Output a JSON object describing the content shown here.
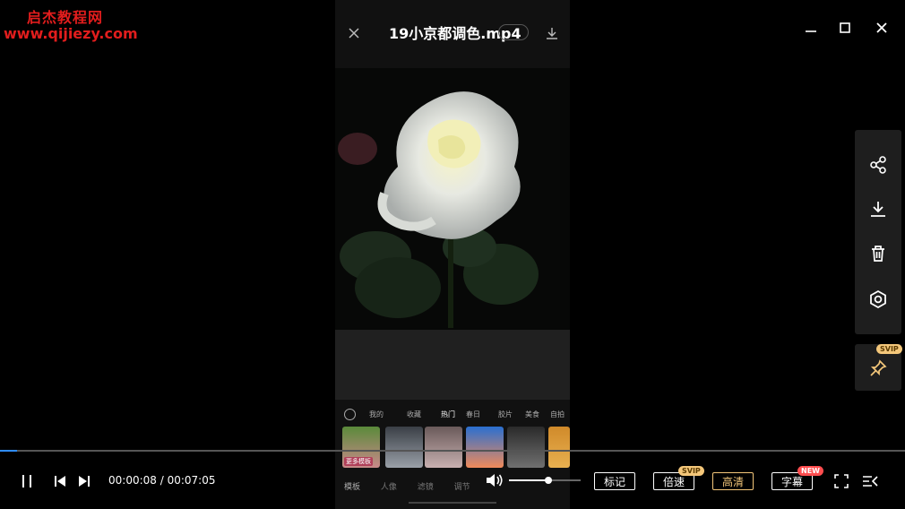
{
  "watermark": {
    "line1": "启杰教程网",
    "line2": "www.qijiezy.com"
  },
  "video": {
    "title": "19小京都调色.mp4"
  },
  "window": {
    "minimize": "minimize-icon",
    "maximize": "maximize-icon",
    "close": "close-icon"
  },
  "side_panel": {
    "items": [
      "share-icon",
      "download-icon",
      "trash-icon",
      "hexagon-icon"
    ],
    "pin_badge": "SVIP"
  },
  "phone_ui": {
    "tabs": [
      "我的",
      "收藏",
      "热门",
      "春日",
      "胶片",
      "美食",
      "自拍"
    ],
    "thumb_label": "更多模板",
    "bottom_tabs": [
      "模板",
      "人像",
      "滤镜",
      "调节"
    ]
  },
  "playback": {
    "current_time": "00:00:08",
    "total_time": "00:07:05",
    "progress": 0.019,
    "volume": 0.55
  },
  "controls": {
    "mark": "标记",
    "speed": "倍速",
    "speed_badge": "SVIP",
    "quality": "高清",
    "subtitle": "字幕",
    "subtitle_badge": "NEW"
  },
  "colors": {
    "accent": "#2f8cff",
    "gold": "#f4c77a",
    "watermark": "#e21d1d",
    "new": "#ff4d4f"
  }
}
